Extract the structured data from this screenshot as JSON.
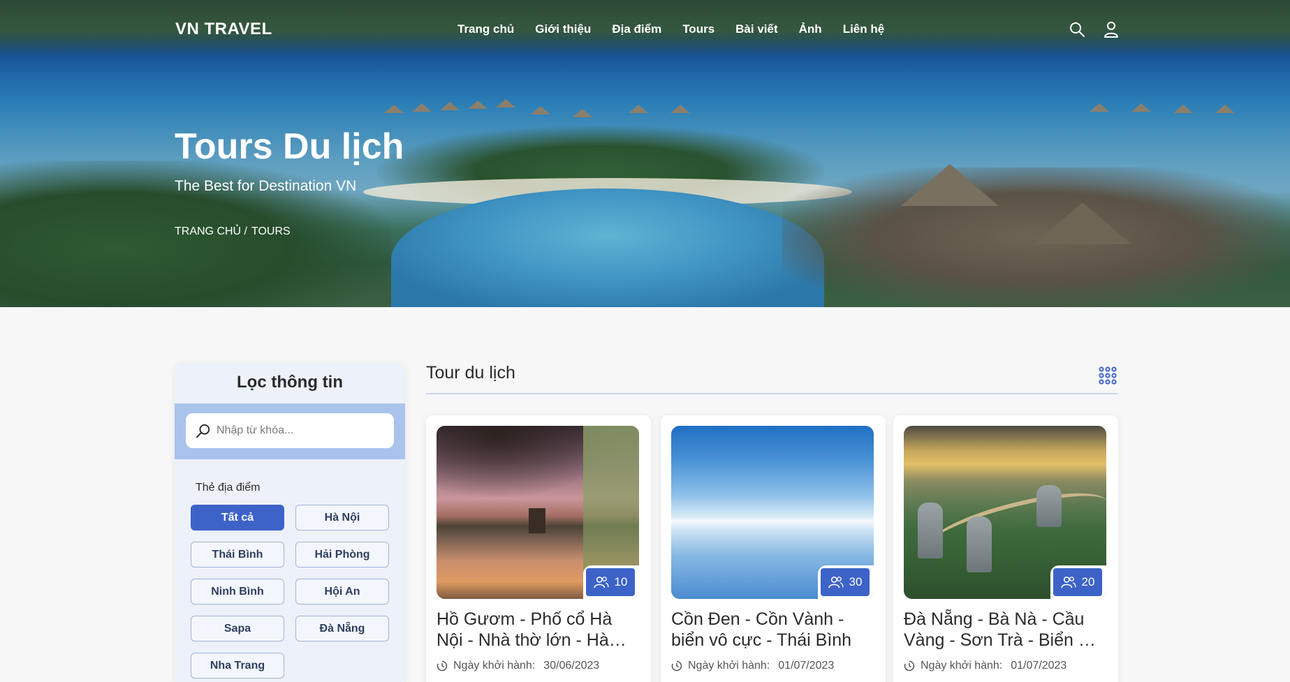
{
  "nav": {
    "logo": "VN TRAVEL",
    "menu": [
      "Trang chủ",
      "Giới thiệu",
      "Địa điểm",
      "Tours",
      "Bài viết",
      "Ảnh",
      "Liên hệ"
    ],
    "icons": [
      "search-icon",
      "user-icon"
    ]
  },
  "hero": {
    "title": "Tours Du lịch",
    "subtitle": "The Best for Destination VN",
    "breadcrumb": [
      "TRANG CHỦ /",
      "TOURS"
    ]
  },
  "sidebar": {
    "title": "Lọc thông tin",
    "search_placeholder": "Nhập từ khóa...",
    "tag_label": "Thẻ địa điểm",
    "tags": [
      "Tất cả",
      "Hà Nội",
      "Thái Bình",
      "Hải Phòng",
      "Ninh Bình",
      "Hội An",
      "Sapa",
      "Đà Nẵng",
      "Nha Trang"
    ],
    "active_tag": "Tất cả"
  },
  "main": {
    "title": "Tour du lịch",
    "cards": [
      {
        "title": "Hồ Gươm - Phố cổ Hà Nội - Nhà thờ lớn - Hà Nội",
        "count": "10",
        "date_label": "Ngày khởi hành:",
        "date": "30/06/2023"
      },
      {
        "title": "Cồn Đen - Cồn Vành - biển vô cực - Thái Bình",
        "count": "30",
        "date_label": "Ngày khởi hành:",
        "date": "01/07/2023"
      },
      {
        "title": "Đà Nẵng - Bà Nà - Cầu Vàng - Sơn Trà - Biển Mỹ Khê",
        "count": "20",
        "date_label": "Ngày khởi hành:",
        "date": "01/07/2023"
      }
    ]
  },
  "colors": {
    "accent": "#3d63c9",
    "search_band": "#a9c3ec",
    "sidebar_bg": "#edf1f9"
  }
}
